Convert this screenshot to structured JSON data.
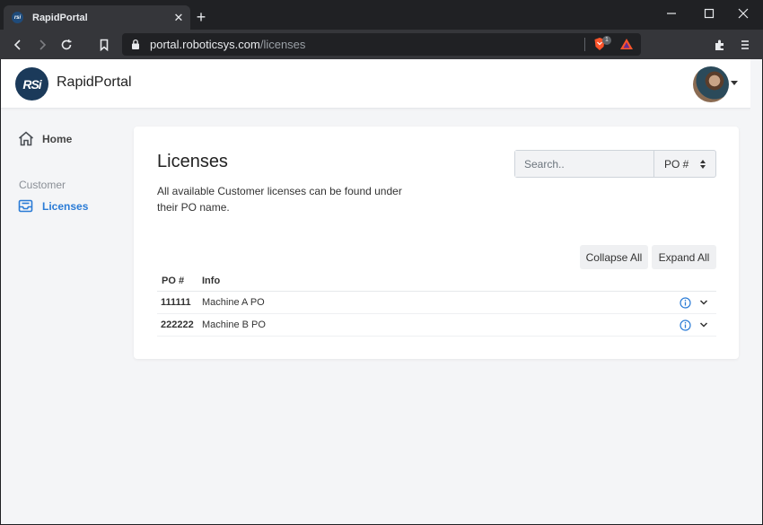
{
  "browser": {
    "tab_title": "RapidPortal",
    "tab_favicon_text": "rsi",
    "new_tab_symbol": "+",
    "close_tab_symbol": "✕",
    "url_host": "portal.roboticsys.com",
    "url_path": "/licenses",
    "shield_count": "1"
  },
  "header": {
    "logo_text": "RSi",
    "brand": "RapidPortal"
  },
  "sidebar": {
    "home_label": "Home",
    "section_label": "Customer",
    "licenses_label": "Licenses"
  },
  "main": {
    "title": "Licenses",
    "description": "All available Customer licenses can be found under their PO name.",
    "search_placeholder": "Search..",
    "search_value": "",
    "sort_field": "PO #",
    "collapse_all_label": "Collapse All",
    "expand_all_label": "Expand All",
    "table": {
      "columns": [
        "PO #",
        "Info"
      ],
      "rows": [
        {
          "po": "111111",
          "info": "Machine A PO"
        },
        {
          "po": "222222",
          "info": "Machine B PO"
        }
      ]
    }
  },
  "colors": {
    "accent": "#2a7bd6",
    "brand_dark": "#1b3a5a",
    "browser_frame": "#202124"
  },
  "icons": [
    "home-icon",
    "licenses-inbox-icon",
    "info-icon",
    "chevron-down-icon",
    "lock-icon",
    "bookmark-icon",
    "reload-icon",
    "back-icon",
    "forward-icon",
    "extensions-icon",
    "menu-icon"
  ]
}
